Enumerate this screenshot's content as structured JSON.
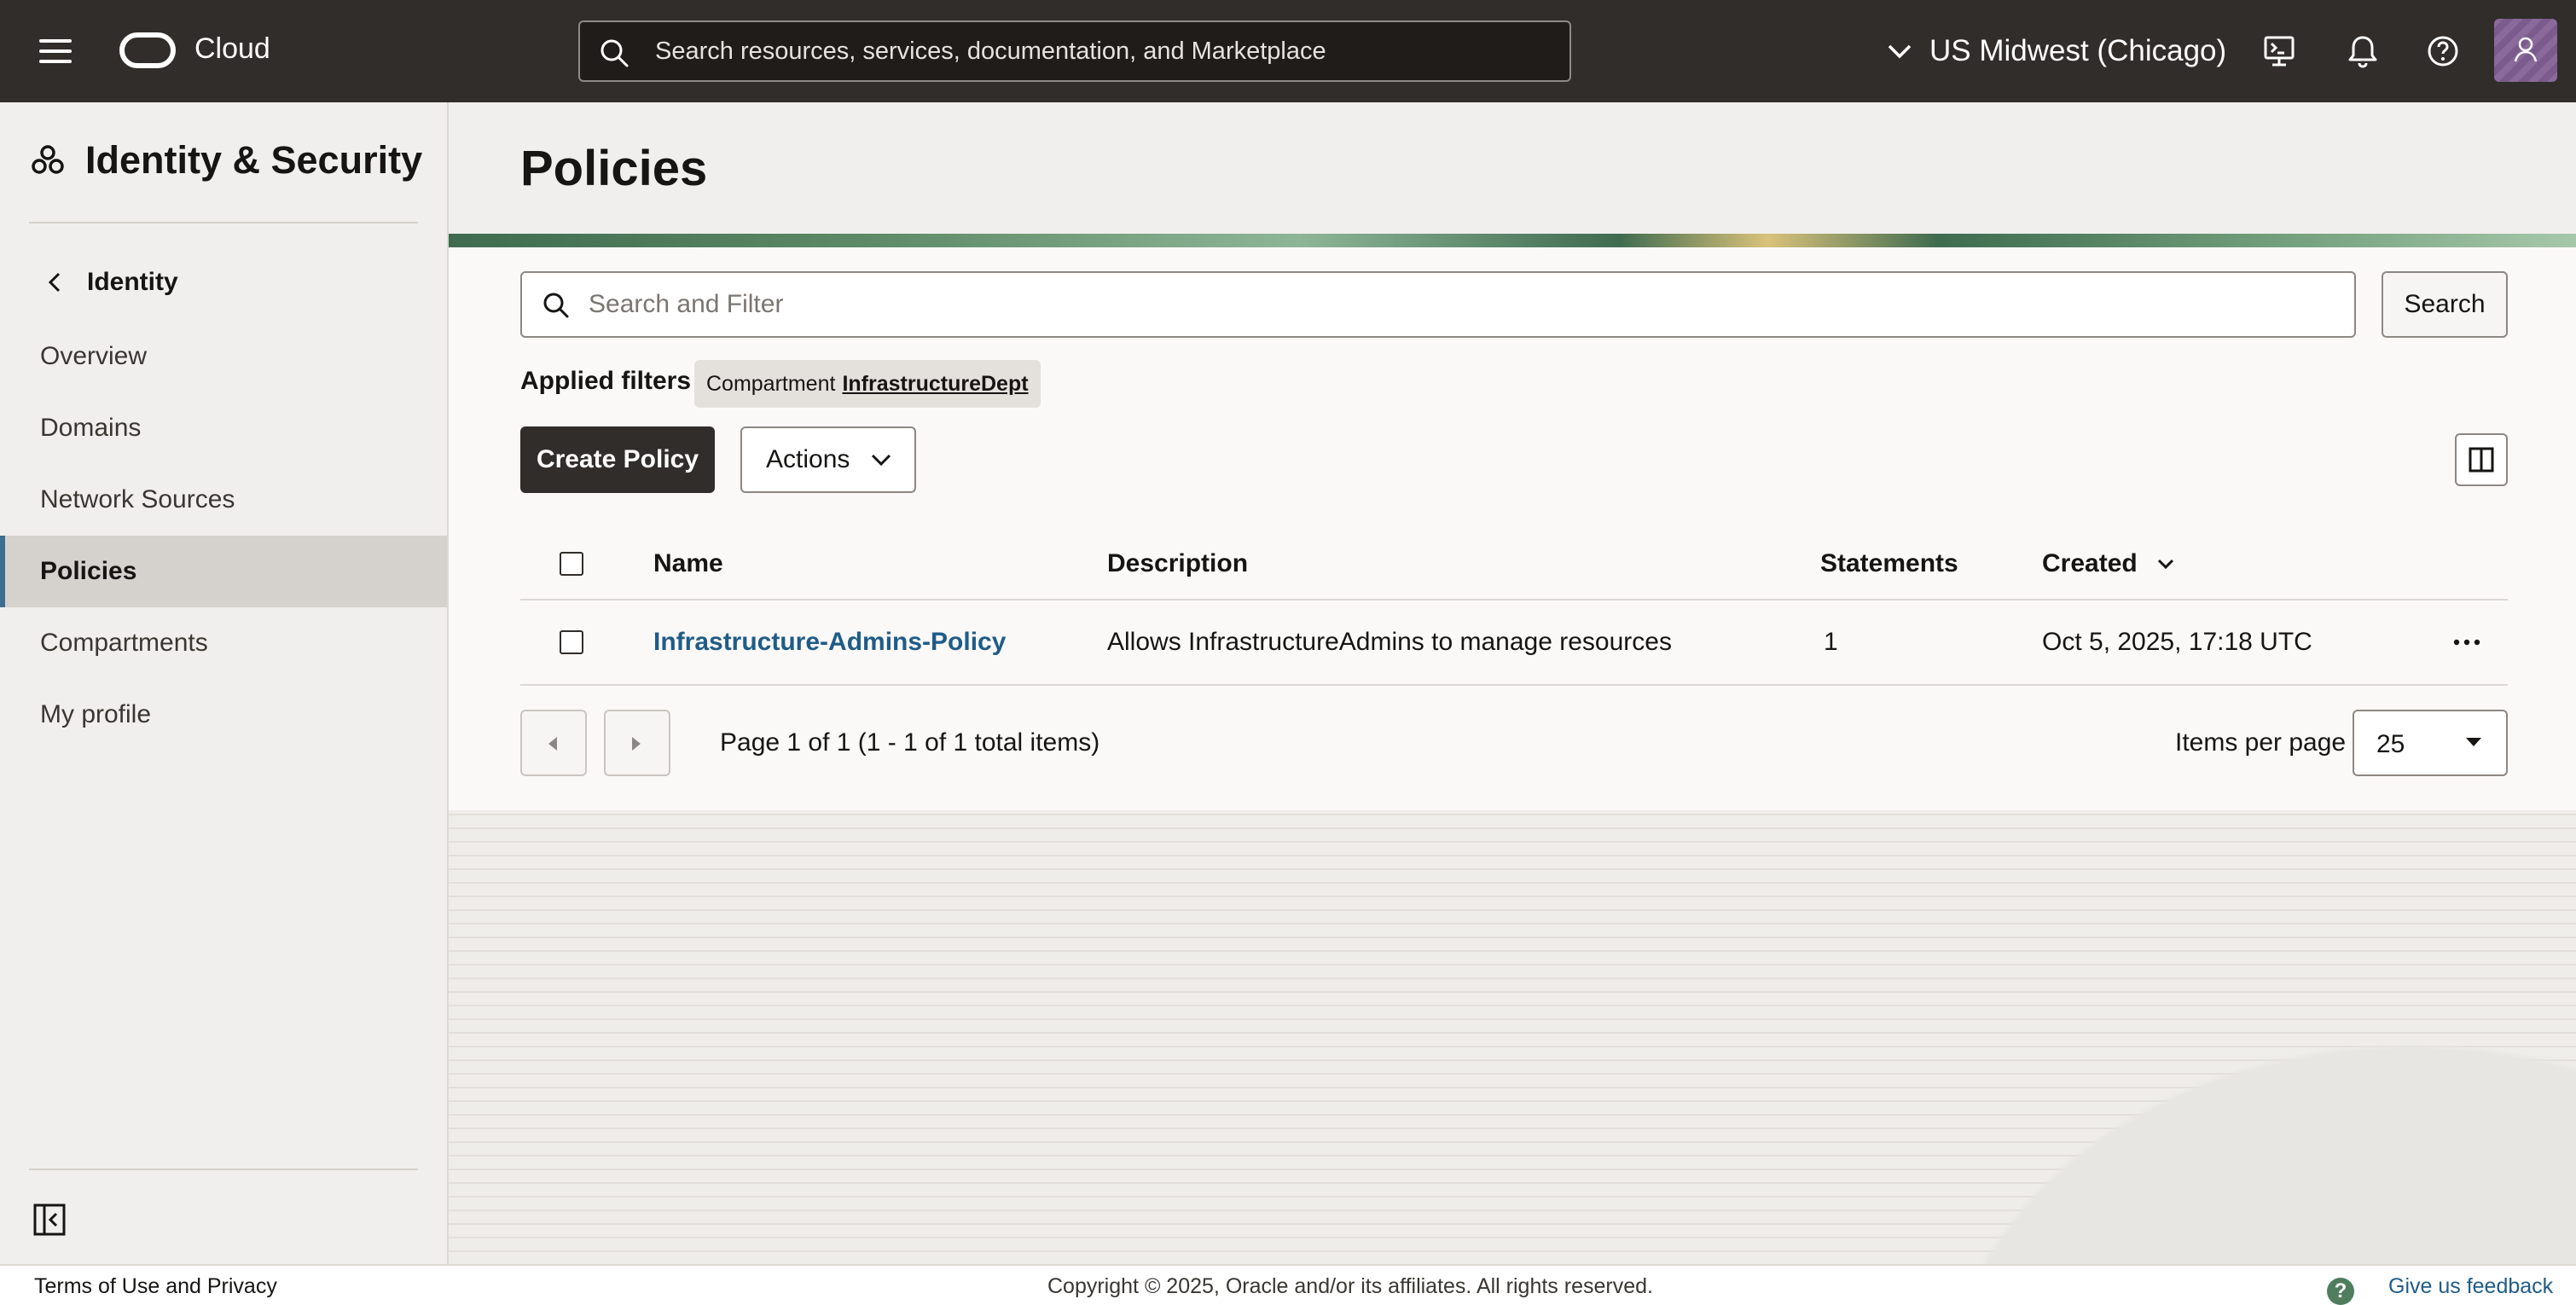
{
  "topbar": {
    "brand": "Cloud",
    "search_placeholder": "Search resources, services, documentation, and Marketplace",
    "region": "US Midwest (Chicago)",
    "icons": [
      "menu-icon",
      "oracle-logo",
      "search-icon",
      "chevron-down-icon",
      "cloud-shell-icon",
      "bell-icon",
      "help-icon",
      "avatar"
    ]
  },
  "sidebar": {
    "title": "Identity & Security",
    "back_label": "Identity",
    "items": [
      {
        "label": "Overview",
        "active": false
      },
      {
        "label": "Domains",
        "active": false
      },
      {
        "label": "Network Sources",
        "active": false
      },
      {
        "label": "Policies",
        "active": true
      },
      {
        "label": "Compartments",
        "active": false
      },
      {
        "label": "My profile",
        "active": false
      }
    ]
  },
  "main": {
    "title": "Policies",
    "filter_placeholder": "Search and Filter",
    "search_button": "Search",
    "applied_filters_label": "Applied filters",
    "chip": {
      "key": "Compartment",
      "value": "InfrastructureDept"
    },
    "create_button": "Create Policy",
    "actions_button": "Actions",
    "table": {
      "columns": [
        "Name",
        "Description",
        "Statements",
        "Created"
      ],
      "rows": [
        {
          "name": "Infrastructure-Admins-Policy",
          "description": "Allows InfrastructureAdmins to manage resources",
          "statements": "1",
          "created": "Oct 5, 2025, 17:18 UTC"
        }
      ]
    },
    "pagination": {
      "page_info": "Page 1 of 1 (1 - 1 of 1 total items)",
      "items_per_page_label": "Items per page",
      "items_per_page": "25"
    }
  },
  "footer": {
    "terms": "Terms of Use and Privacy",
    "copyright": "Copyright © 2025, Oracle and/or its affiliates. All rights reserved.",
    "feedback": "Give us feedback",
    "feedback_icon_glyph": "?"
  },
  "colors": {
    "topbar": "#312d2a",
    "link": "#1f5c88",
    "active_nav": "#d5d2ce",
    "primary_button": "#312d2a"
  }
}
